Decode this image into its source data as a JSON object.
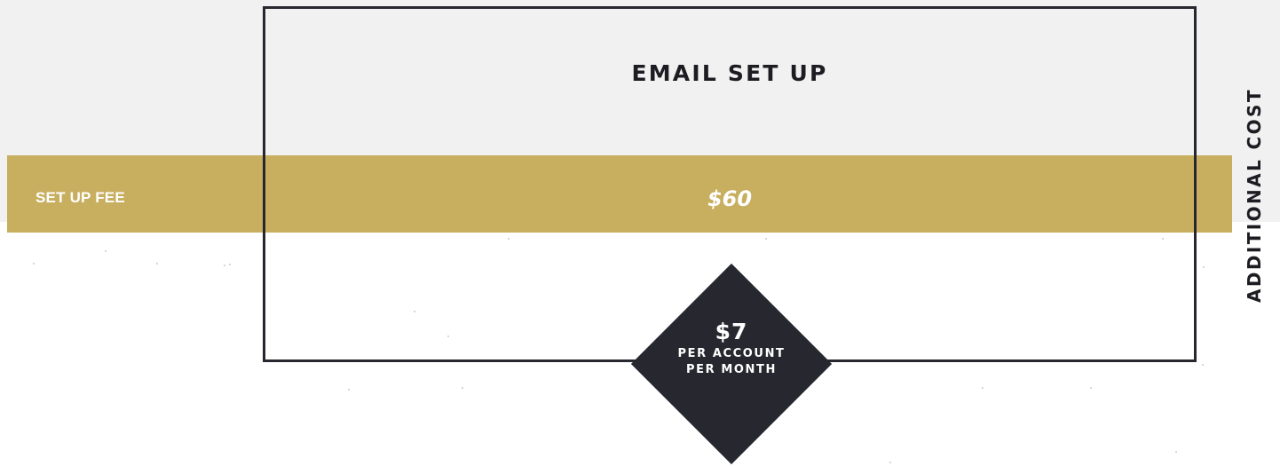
{
  "card": {
    "title": "EMAIL SET UP"
  },
  "fee_row": {
    "label": "SET UP FEE",
    "price": "$60"
  },
  "badge": {
    "price": "$7",
    "line1": "PER ACCOUNT",
    "line2": "PER MONTH"
  },
  "side_label": "ADDITIONAL COST",
  "colors": {
    "gold": "#c8ae5f",
    "dark": "#27272f",
    "light_bg": "#f1f1f1",
    "white": "#ffffff"
  }
}
